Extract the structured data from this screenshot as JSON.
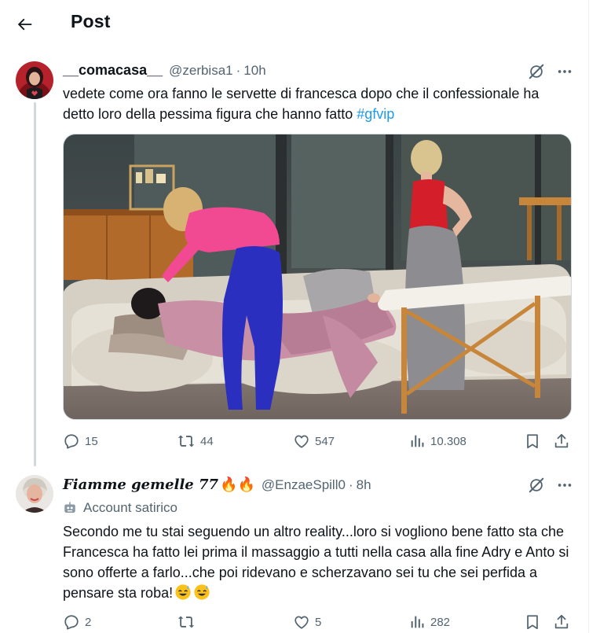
{
  "header": {
    "title": "Post"
  },
  "tweet": {
    "display_name": "__comacasa__",
    "handle": "@zerbisa1",
    "separator": "·",
    "time": "10h",
    "text": "vedete come ora fanno le servette di francesca dopo che il confessionale ha detto loro della pessima figura che hanno fatto",
    "hashtag": "#gfvip",
    "stats": {
      "replies": "15",
      "reposts": "44",
      "likes": "547",
      "views": "10.308"
    }
  },
  "reply": {
    "display_name": "Fiamme gemelle 77",
    "name_emoji": "🔥🔥",
    "handle": "@EnzaeSpill0",
    "separator": "·",
    "time": "8h",
    "label": "Account satirico",
    "text": "Secondo me tu stai seguendo un altro reality...loro si vogliono bene fatto sta che Francesca ha fatto lei prima il massaggio a tutti nella casa alla fine Adry e Anto si sono offerte a farlo...che poi ridevano e scherzavano sei tu che sei perfida a pensare sta roba!",
    "stats": {
      "replies": "2",
      "reposts": "",
      "likes": "5",
      "views": "282"
    }
  },
  "icons": {
    "back": "arrow-left-icon",
    "grok": "grok-icon",
    "more": "more-icon",
    "reply": "reply-icon",
    "repost": "repost-icon",
    "like": "heart-icon",
    "views": "views-icon",
    "bookmark": "bookmark-icon",
    "share": "share-icon",
    "satire": "robot-icon"
  },
  "colors": {
    "accent": "#1d9bf0",
    "text": "#0f1419",
    "muted": "#536471",
    "border": "#eff3f4"
  }
}
